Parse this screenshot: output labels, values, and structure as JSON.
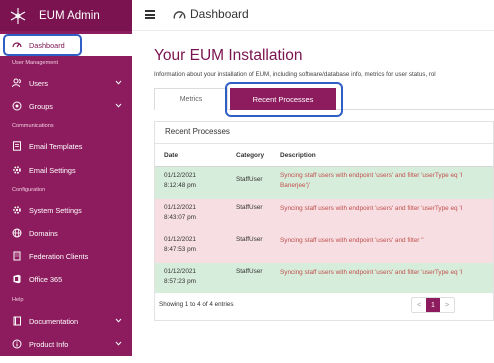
{
  "app": {
    "title": "EUM Admin"
  },
  "topbar": {
    "title": "Dashboard"
  },
  "sidebar": {
    "items": [
      {
        "label": "Dashboard"
      },
      {
        "label": "Users"
      },
      {
        "label": "Groups"
      },
      {
        "label": "Email Templates"
      },
      {
        "label": "Email Settings"
      },
      {
        "label": "System Settings"
      },
      {
        "label": "Domains"
      },
      {
        "label": "Federation Clients"
      },
      {
        "label": "Office 365"
      },
      {
        "label": "Documentation"
      },
      {
        "label": "Product Info"
      }
    ],
    "sections": {
      "user_management": "User Management",
      "communications": "Communications",
      "configuration": "Configuration",
      "help": "Help"
    }
  },
  "main": {
    "title": "Your EUM Installation",
    "description": "Information about your installation of EUM, including software/database info, metrics for user status, rol",
    "tabs": [
      {
        "label": "Metrics"
      },
      {
        "label": "Recent Processes"
      }
    ]
  },
  "recent": {
    "title": "Recent Processes",
    "columns": {
      "date": "Date",
      "category": "Category",
      "description": "Description"
    },
    "rows": [
      {
        "date": "01/12/2021\n8:12:48 pm",
        "category": "StaffUser",
        "description": "Syncing staff users with endpoint 'users' and filter 'userType eq 'I\nBanerjee')'",
        "status": "green"
      },
      {
        "date": "01/12/2021\n8:43:07 pm",
        "category": "StaffUser",
        "description": "Syncing staff users with endpoint 'users' and filter 'userType eq 'I",
        "status": "red"
      },
      {
        "date": "01/12/2021\n8:47:53 pm",
        "category": "StaffUser",
        "description": "Syncing staff users with endpoint 'users' and filter ''",
        "status": "red"
      },
      {
        "date": "01/12/2021\n8:57:23 pm",
        "category": "StaffUser",
        "description": "Syncing staff users with endpoint 'users' and filter 'userType eq 'I",
        "status": "green"
      }
    ],
    "footer": "Showing 1 to 4 of 4 entries",
    "pager": {
      "prev": "<",
      "page": "1",
      "next": ">"
    }
  },
  "colors": {
    "brand": "#8d1c5e",
    "brand_dark": "#7b1350",
    "highlight": "#2f5ec4",
    "row_success": "#d7eddb",
    "row_error": "#f7dee2",
    "text_error": "#c0504d"
  },
  "icons": {
    "logo": "snowflake-logo-icon",
    "menu": "hamburger-icon",
    "dashboard": "gauge-icon"
  }
}
